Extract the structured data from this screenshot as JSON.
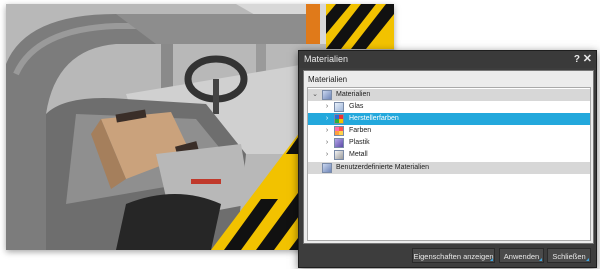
{
  "dialog": {
    "title": "Materialien",
    "help_icon": "?",
    "close_icon": "✕",
    "section_label": "Materialien",
    "tree": {
      "root_label": "Materialien",
      "items": [
        {
          "label": "Glas",
          "icon": "glass-swatch-icon"
        },
        {
          "label": "Herstellerfarben",
          "icon": "manufacturer-colors-icon"
        },
        {
          "label": "Farben",
          "icon": "colors-icon"
        },
        {
          "label": "Plastik",
          "icon": "plastic-swatch-icon"
        },
        {
          "label": "Metall",
          "icon": "metal-swatch-icon"
        }
      ],
      "user_root_label": "Benutzerdefinierte Materialien"
    },
    "buttons": {
      "properties": "Eigenschaften anzeigen",
      "apply": "Anwenden",
      "close": "Schließen"
    }
  },
  "colors": {
    "selection": "#23a8dc",
    "dialog_frame": "#3d3d3d",
    "hazard_yellow": "#f2c200"
  }
}
